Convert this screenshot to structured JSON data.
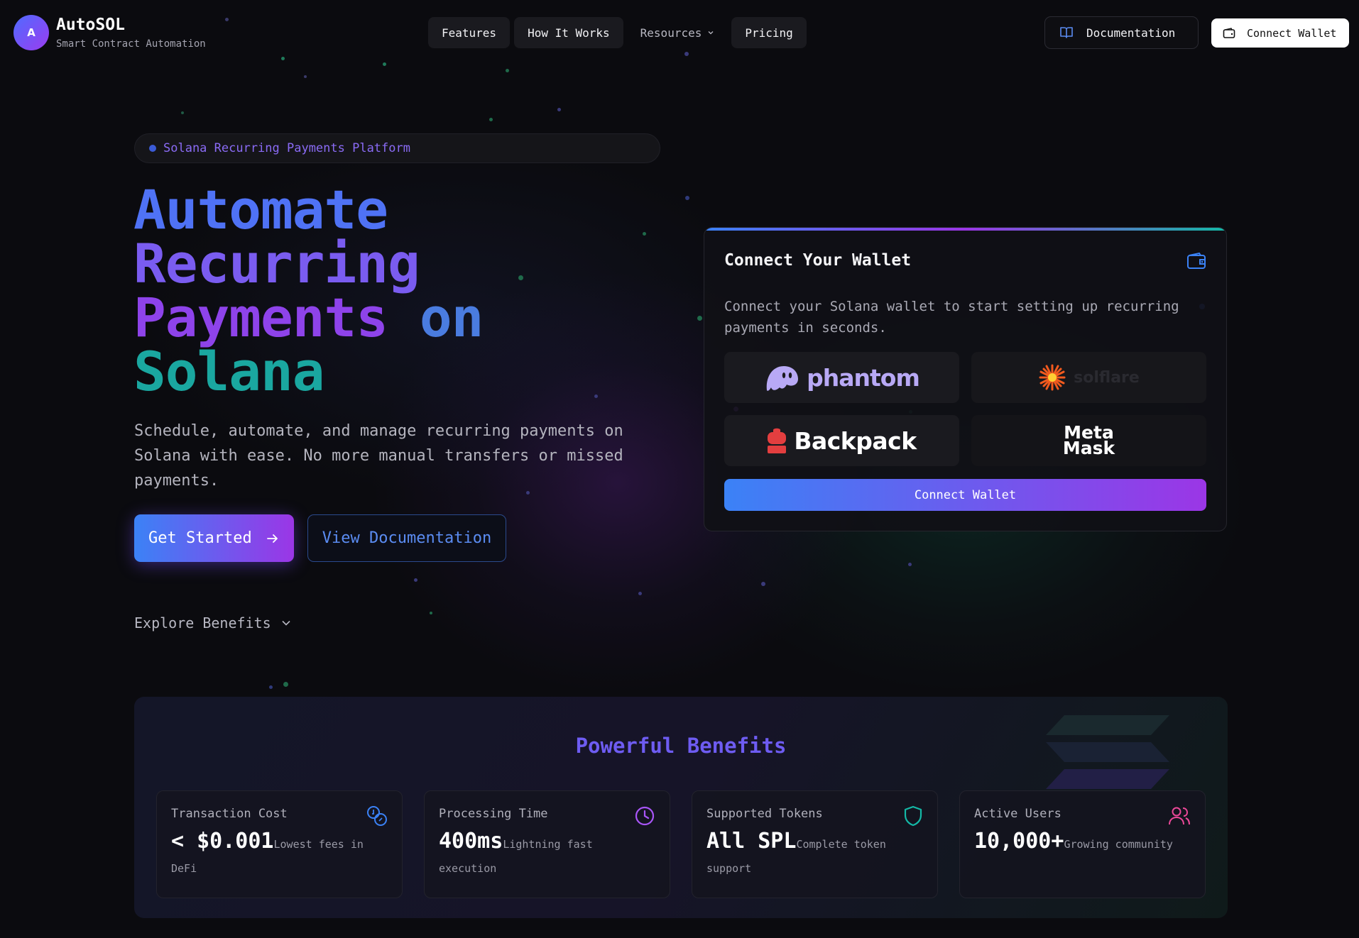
{
  "header": {
    "logo_letter": "A",
    "app_name": "AutoSOL",
    "tagline": "Smart Contract Automation",
    "nav": [
      {
        "label": "Features"
      },
      {
        "label": "How It Works"
      },
      {
        "label": "Resources"
      },
      {
        "label": "Pricing"
      }
    ],
    "documentation_label": "Documentation",
    "connect_wallet_label": "Connect Wallet"
  },
  "hero": {
    "badge": "Solana Recurring Payments Platform",
    "headline": {
      "line1": "Automate",
      "line2": "Recurring",
      "line3a": "Payments",
      "line3b": "on",
      "line4": "Solana"
    },
    "description": "Schedule, automate, and manage recurring payments on Solana with ease. No more manual transfers or missed payments.",
    "primary_cta": "Get Started",
    "secondary_cta": "View Documentation",
    "explore": "Explore Benefits"
  },
  "wallet_card": {
    "title": "Connect Your Wallet",
    "description": "Connect your Solana wallet to start setting up recurring payments in seconds.",
    "wallets": [
      {
        "name": "phantom"
      },
      {
        "name": "solflare"
      },
      {
        "name": "Backpack"
      },
      {
        "name_line1": "Meta",
        "name_line2": "Mask"
      }
    ],
    "button": "Connect Wallet"
  },
  "benefits": {
    "title": "Powerful Benefits",
    "items": [
      {
        "label": "Transaction Cost",
        "value": "< $0.001",
        "note": "Lowest fees in DeFi",
        "icon": "coins-icon",
        "color": "#3b82f6"
      },
      {
        "label": "Processing Time",
        "value": "400ms",
        "note": "Lightning fast execution",
        "icon": "clock-icon",
        "color": "#a855f7"
      },
      {
        "label": "Supported Tokens",
        "value": "All SPL",
        "note": "Complete token support",
        "icon": "shield-icon",
        "color": "#14b8a6"
      },
      {
        "label": "Active Users",
        "value": "10,000+",
        "note": "Growing community",
        "icon": "users-icon",
        "color": "#ec4899"
      }
    ]
  },
  "colors": {
    "accent_blue": "#3b82f6",
    "accent_purple": "#9b36e6",
    "accent_teal": "#14b8a6",
    "background": "#0b0b0f"
  }
}
